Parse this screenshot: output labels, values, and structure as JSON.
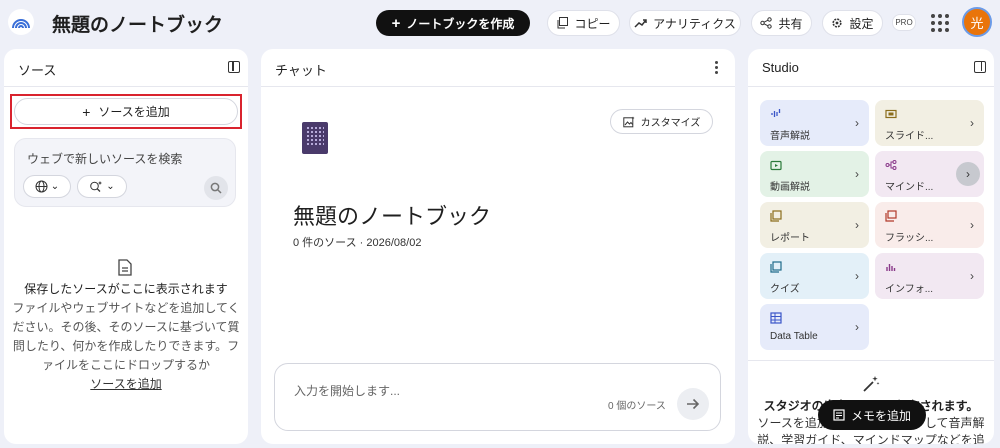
{
  "header": {
    "title": "無題のノートブック",
    "create_label": "ノートブックを作成",
    "copy_label": "コピー",
    "analytics_label": "アナリティクス",
    "share_label": "共有",
    "settings_label": "設定",
    "pro_badge": "PRO",
    "avatar_initial": "光"
  },
  "sources": {
    "title": "ソース",
    "add_label": "ソースを追加",
    "search_placeholder": "ウェブで新しいソースを検索",
    "empty_title": "保存したソースがここに表示されます",
    "empty_body": "ファイルやウェブサイトなどを追加してください。その後、そのソースに基づいて質問したり、何かを作成したりできます。ファイルをここにドロップするか",
    "empty_link": "ソースを追加"
  },
  "chat": {
    "title": "チャット",
    "customize_label": "カスタマイズ",
    "notebook_title": "無題のノートブック",
    "notebook_meta": "0 件のソース · 2026/08/02",
    "input_placeholder": "入力を開始します...",
    "source_count": "0 個のソース"
  },
  "studio": {
    "title": "Studio",
    "cards": [
      {
        "label": "音声解説",
        "color": "#e6ebfa",
        "icon": "audio-wave-icon"
      },
      {
        "label": "スライド...",
        "color": "#f2efe3",
        "icon": "slides-icon"
      },
      {
        "label": "動画解説",
        "color": "#e3f2e6",
        "icon": "video-icon"
      },
      {
        "label": "マインド...",
        "color": "#f2e8f2",
        "icon": "mindmap-icon"
      },
      {
        "label": "レポート",
        "color": "#f2efe3",
        "icon": "report-icon"
      },
      {
        "label": "フラッシ...",
        "color": "#f9ecea",
        "icon": "flashcard-icon"
      },
      {
        "label": "クイズ",
        "color": "#e3f0f8",
        "icon": "quiz-icon"
      },
      {
        "label": "インフォ...",
        "color": "#f2e8f2",
        "icon": "infographic-icon"
      },
      {
        "label": "Data Table",
        "color": "#e6ebfa",
        "icon": "table-icon"
      }
    ],
    "desc_title": "スタジオの出力はここに保存されます。",
    "desc_body": "ソースを追加したら、クリックして音声解説、学習ガイド、マインドマップなどを追加",
    "memo_label": "メモを追加"
  }
}
